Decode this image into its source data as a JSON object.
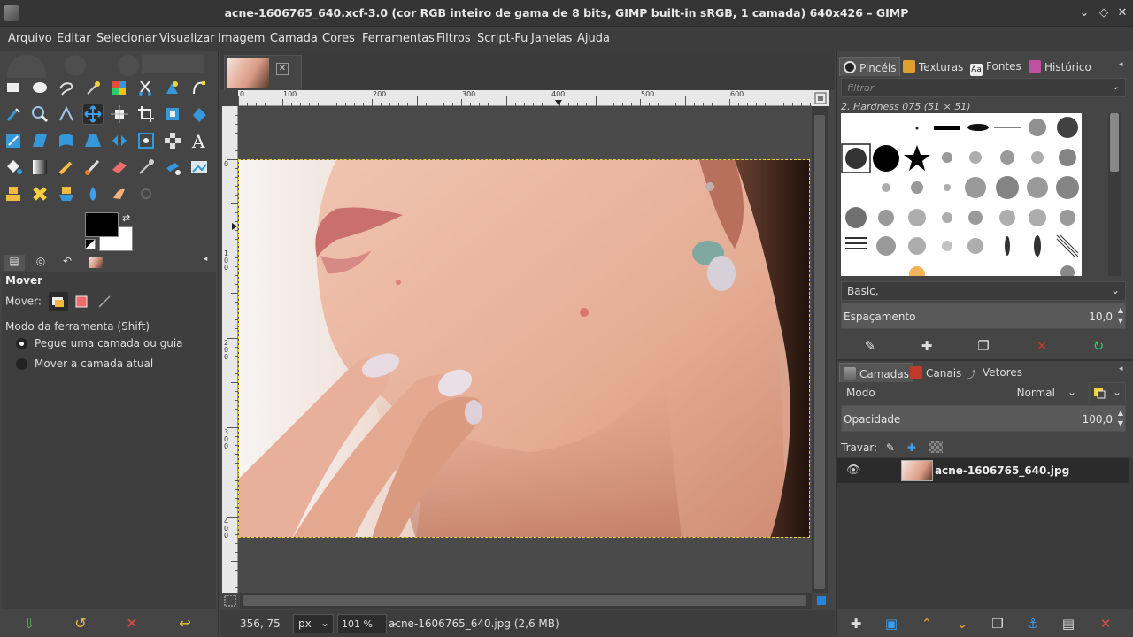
{
  "window": {
    "title": "acne-1606765_640.xcf-3.0 (cor RGB inteiro de gama de 8 bits, GIMP built-in sRGB, 1 camada) 640x426 – GIMP"
  },
  "menu": [
    "Arquivo",
    "Editar",
    "Selecionar",
    "Visualizar",
    "Imagem",
    "Camada",
    "Cores",
    "Ferramentas",
    "Filtros",
    "Script-Fu",
    "Janelas",
    "Ajuda"
  ],
  "tool_options": {
    "title": "Mover",
    "move_label": "Mover:",
    "mode_label": "Modo da ferramenta (Shift)",
    "option1": "Pegue uma camada ou guia",
    "option2": "Mover a camada atual"
  },
  "ruler": {
    "h_labels": [
      "0",
      "100",
      "200",
      "300",
      "400",
      "500",
      "600"
    ],
    "v_labels": [
      "0",
      "1\n0\n0",
      "2\n0\n0",
      "3\n0\n0",
      "4\n0\n0"
    ]
  },
  "status": {
    "coords": "356, 75",
    "unit": "px",
    "zoom": "101 %",
    "file": "acne-1606765_640.jpg (2,6 MB)"
  },
  "brushes_dock": {
    "tabs": [
      "Pincéis",
      "Texturas",
      "Fontes",
      "Histórico"
    ],
    "filter_placeholder": "filtrar",
    "brush_name": "2. Hardness 075 (51 × 51)",
    "preset": "Basic,",
    "spacing_label": "Espaçamento",
    "spacing_value": "10,0"
  },
  "layers_dock": {
    "tabs": [
      "Camadas",
      "Canais",
      "Vetores"
    ],
    "mode_label": "Modo",
    "mode_value": "Normal",
    "opacity_label": "Opacidade",
    "opacity_value": "100,0",
    "lock_label": "Travar:",
    "layer_name": "acne-1606765_640.jpg"
  },
  "colors": {
    "accent": "#2a82da",
    "selection": "#f0d030"
  }
}
